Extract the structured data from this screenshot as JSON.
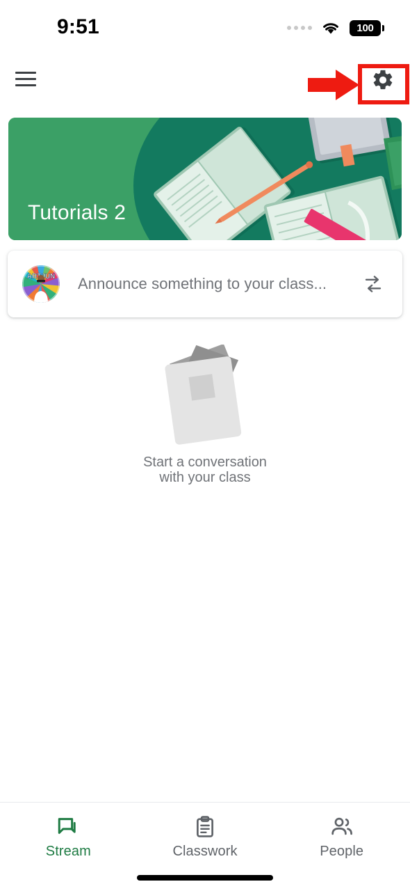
{
  "status_bar": {
    "time": "9:51",
    "signal_icon": "signal-dots-icon",
    "wifi_icon": "wifi-icon",
    "battery_level": "100",
    "battery_icon": "battery-full-icon"
  },
  "app_bar": {
    "menu_icon": "hamburger-menu-icon",
    "settings_icon": "gear-icon"
  },
  "annotation": {
    "arrow_icon": "red-arrow-right-icon",
    "highlight_color": "#ee1b11",
    "target": "settings-button"
  },
  "banner": {
    "class_title": "Tutorials 2",
    "background_color": "#3ba066",
    "accent_color": "#137a5f",
    "paper_color": "#cfe5d8",
    "pencil_color": "#f08a5d",
    "ruler_color": "#e8356d"
  },
  "announce_card": {
    "avatar_label": "ARTJUN",
    "avatar_icon": "user-avatar",
    "placeholder": "Announce something to your class...",
    "swap_icon": "swap-arrows-icon"
  },
  "empty_state": {
    "illustration_icon": "stacked-papers-icon",
    "line1": "Start a conversation",
    "line2": "with your class"
  },
  "bottom_nav": {
    "active_color": "#1e7b43",
    "inactive_color": "#5f6368",
    "items": [
      {
        "label": "Stream",
        "icon": "chat-bubbles-icon",
        "active": true
      },
      {
        "label": "Classwork",
        "icon": "clipboard-icon",
        "active": false
      },
      {
        "label": "People",
        "icon": "people-icon",
        "active": false
      }
    ]
  },
  "home_indicator": "home-indicator-bar"
}
